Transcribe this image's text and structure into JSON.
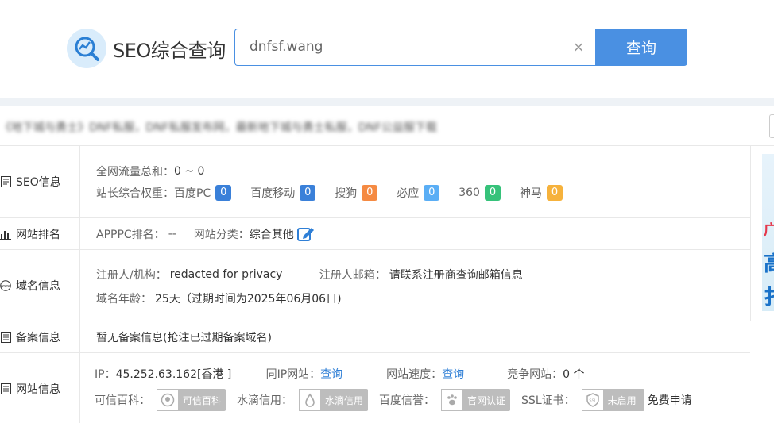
{
  "header": {
    "logo_text": "SEO综合查询",
    "search_value": "dnfsf.wang",
    "clear_icon": "×",
    "search_button": "查询"
  },
  "site_description": "《地下城与勇士》DNF私服，DNF私服发布网，最新地下城与勇士私服，DNF公益服下载",
  "colors": {
    "accent": "#4a90e2",
    "badge_blue": "#3a80d9",
    "badge_orange": "#f58a42",
    "badge_lightblue": "#5aaef5",
    "badge_green": "#36c27a",
    "badge_yellow": "#f6b23c"
  },
  "seo": {
    "label": "SEO信息",
    "traffic_label": "全网流量总和：",
    "traffic_value": "0 ~ 0",
    "weight_label": "站长综合权重：",
    "engines": [
      {
        "name": "百度PC",
        "value": "0",
        "color": "#3a80d9"
      },
      {
        "name": "百度移动",
        "value": "0",
        "color": "#3a80d9"
      },
      {
        "name": "搜狗",
        "value": "0",
        "color": "#f58a42"
      },
      {
        "name": "必应",
        "value": "0",
        "color": "#5aaef5"
      },
      {
        "name": "360",
        "value": "0",
        "color": "#36c27a"
      },
      {
        "name": "神马",
        "value": "0",
        "color": "#f6b23c"
      }
    ]
  },
  "rank": {
    "label": "网站排名",
    "apppc_label": "APPPC排名：",
    "apppc_value": "--",
    "category_label": "网站分类：",
    "category_value": "综合其他"
  },
  "domain": {
    "label": "域名信息",
    "registrant_label": "注册人/机构：",
    "registrant_value": "redacted for privacy",
    "email_label": "注册人邮箱：",
    "email_value": "请联系注册商查询邮箱信息",
    "age_label": "域名年龄：",
    "age_value": "25天（过期时间为2025年06月06日)"
  },
  "icp": {
    "label": "备案信息",
    "value": "暂无备案信息(抢注已过期备案域名)"
  },
  "site": {
    "label": "网站信息",
    "ip_label": "IP：",
    "ip_value": "45.252.63.162[香港 ]",
    "same_ip_label": "同IP网站：",
    "same_ip_link": "查询",
    "speed_label": "网站速度：",
    "speed_link": "查询",
    "competitor_label": "竞争网站：",
    "competitor_value": "0 个",
    "cred_items": [
      {
        "label": "可信百科：",
        "badge": "可信百科"
      },
      {
        "label": "水滴信用：",
        "badge": "水滴信用"
      },
      {
        "label": "百度信誉：",
        "badge": "官网认证"
      },
      {
        "label": "SSL证书：",
        "badge": "未启用"
      }
    ],
    "free_apply": "免费申请"
  },
  "ad": {
    "chars": [
      "广",
      "高",
      "扌"
    ]
  }
}
